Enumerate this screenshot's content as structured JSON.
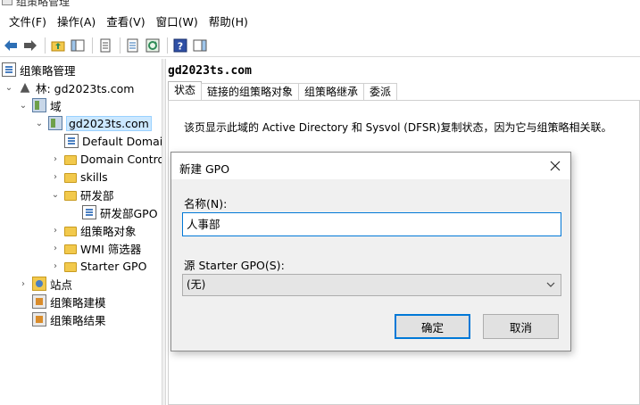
{
  "window": {
    "title": "组策略管理"
  },
  "menu": [
    "文件(F)",
    "操作(A)",
    "查看(V)",
    "窗口(W)",
    "帮助(H)"
  ],
  "toolbar": {
    "icons": [
      "back-arrow-icon",
      "forward-arrow-icon",
      "up-folder-icon",
      "show-hide-tree-icon",
      "properties-icon",
      "export-list-icon",
      "refresh-icon",
      "help-icon",
      "action-pane-icon"
    ]
  },
  "tree": {
    "root": "组策略管理",
    "forest": "林: gd2023ts.com",
    "domains": "域",
    "domain": "gd2023ts.com",
    "default_domain_policy": "Default Domai",
    "domain_controllers": "Domain Contro",
    "skills": "skills",
    "rnd": "研发部",
    "rnd_gpo": "研发部GPO",
    "gpo_objects": "组策略对象",
    "wmi_filters": "WMI 筛选器",
    "starter_gpo": "Starter GPO",
    "sites": "站点",
    "modeling": "组策略建模",
    "results": "组策略结果"
  },
  "content": {
    "title": "gd2023ts.com",
    "tabs": [
      "状态",
      "链接的组策略对象",
      "组策略继承",
      "委派"
    ],
    "description": "该页显示此域的 Active Directory 和 Sysvol (DFSR)复制状态，因为它与组策略相关联。"
  },
  "dialog": {
    "title": "新建 GPO",
    "name_label": "名称(N):",
    "name_value": "人事部",
    "starter_label": "源 Starter GPO(S):",
    "starter_value": "(无)",
    "ok": "确定",
    "cancel": "取消"
  }
}
